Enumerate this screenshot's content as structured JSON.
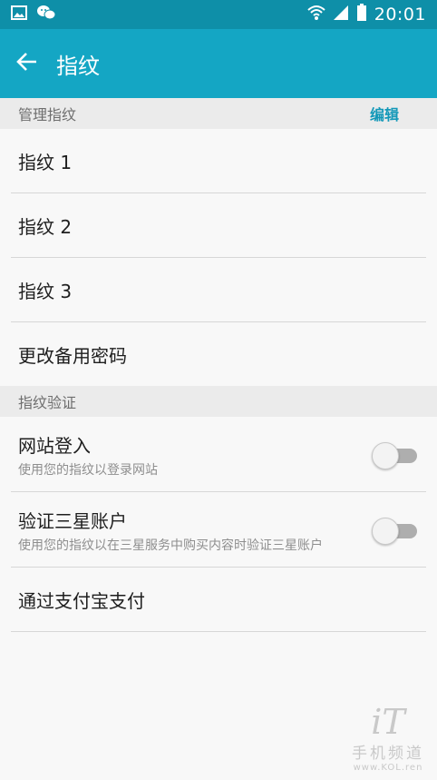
{
  "status_bar": {
    "time": "20:01",
    "icons": [
      "image-icon",
      "wechat-icon",
      "wifi-icon",
      "signal-icon",
      "battery-icon"
    ]
  },
  "app_bar": {
    "title": "指纹",
    "back_icon": "arrow-left-icon"
  },
  "sections": {
    "manage": {
      "header": "管理指纹",
      "edit_label": "编辑",
      "items": [
        "指纹 1",
        "指纹 2",
        "指纹 3",
        "更改备用密码"
      ]
    },
    "verify": {
      "header": "指纹验证",
      "web_login": {
        "title": "网站登入",
        "subtitle": "使用您的指纹以登录网站",
        "enabled": false
      },
      "samsung_account": {
        "title": "验证三星账户",
        "subtitle": "使用您的指纹以在三星服务中购买内容时验证三星账户",
        "enabled": false
      },
      "alipay": "通过支付宝支付"
    }
  },
  "watermark": {
    "logo": "iT",
    "title": "手机频道",
    "url": "www.KOL.ren"
  },
  "colors": {
    "status_bar": "#0e8fa8",
    "app_bar": "#14a6c4",
    "accent": "#1398b8"
  }
}
